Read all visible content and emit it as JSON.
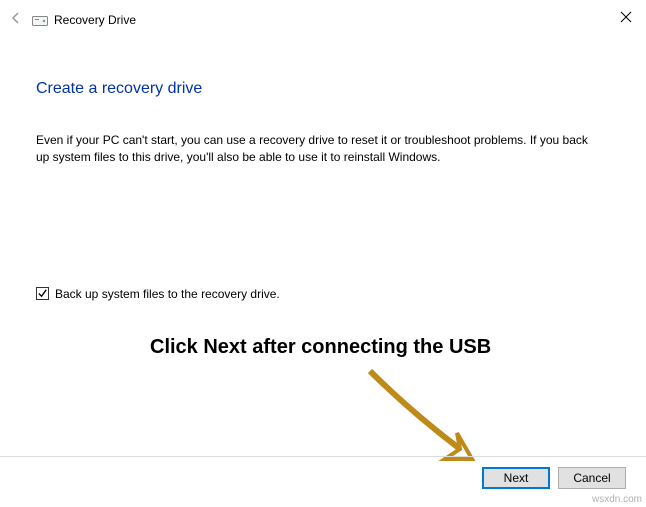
{
  "window": {
    "title": "Recovery Drive"
  },
  "heading": "Create a recovery drive",
  "body_text": "Even if your PC can't start, you can use a recovery drive to reset it or troubleshoot problems. If you back up system files to this drive, you'll also be able to use it to reinstall Windows.",
  "checkbox": {
    "label": "Back up system files to the recovery drive.",
    "checked": true
  },
  "buttons": {
    "next": "Next",
    "cancel": "Cancel"
  },
  "annotation": "Click Next after connecting the USB",
  "watermark": "wsxdn.com"
}
